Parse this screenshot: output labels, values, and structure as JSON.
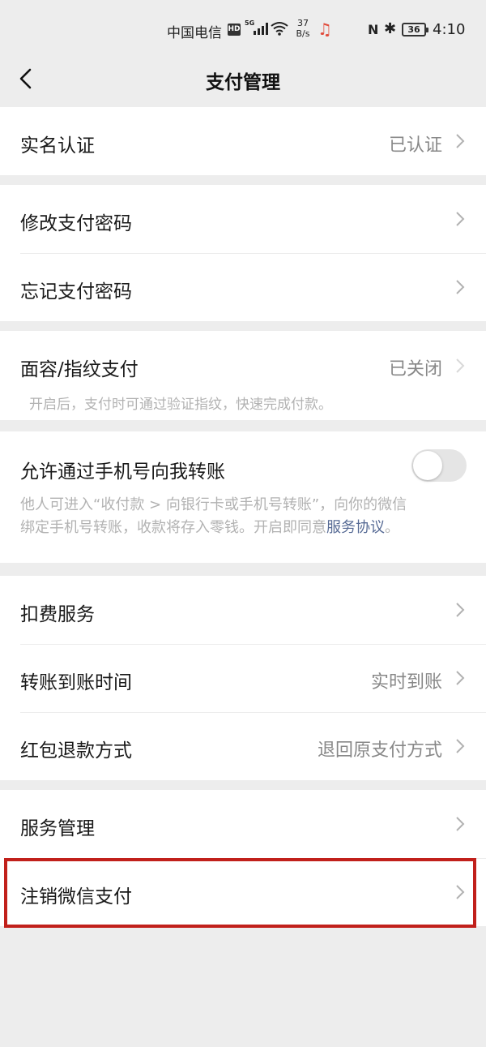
{
  "status_bar": {
    "carrier": "中国电信",
    "hd": "HD",
    "network": "5G",
    "speed_value": "37",
    "speed_unit": "B/s",
    "battery": "36",
    "time": "4:10"
  },
  "nav": {
    "title": "支付管理"
  },
  "real_name": {
    "label": "实名认证",
    "value": "已认证"
  },
  "password": {
    "change_label": "修改支付密码",
    "forgot_label": "忘记支付密码"
  },
  "biometric": {
    "label": "面容/指纹支付",
    "value": "已关闭",
    "description": "开启后，支付时可通过验证指纹，快速完成付款。"
  },
  "phone_transfer": {
    "label": "允许通过手机号向我转账",
    "toggle_on": false,
    "description_line1": "他人可进入“收付款 > 向银行卡或手机号转账”，向你的微信",
    "description_line2": "绑定手机号转账，收款将存入零钱。开启即同意",
    "link": "服务协议",
    "description_end": "。"
  },
  "services": {
    "deduction_label": "扣费服务",
    "transfer_time_label": "转账到账时间",
    "transfer_time_value": "实时到账",
    "red_packet_label": "红包退款方式",
    "red_packet_value": "退回原支付方式"
  },
  "manage": {
    "service_manage_label": "服务管理",
    "cancel_pay_label": "注销微信支付"
  },
  "colors": {
    "background": "#ededed",
    "link": "#576b95",
    "highlight": "#c1201b"
  }
}
